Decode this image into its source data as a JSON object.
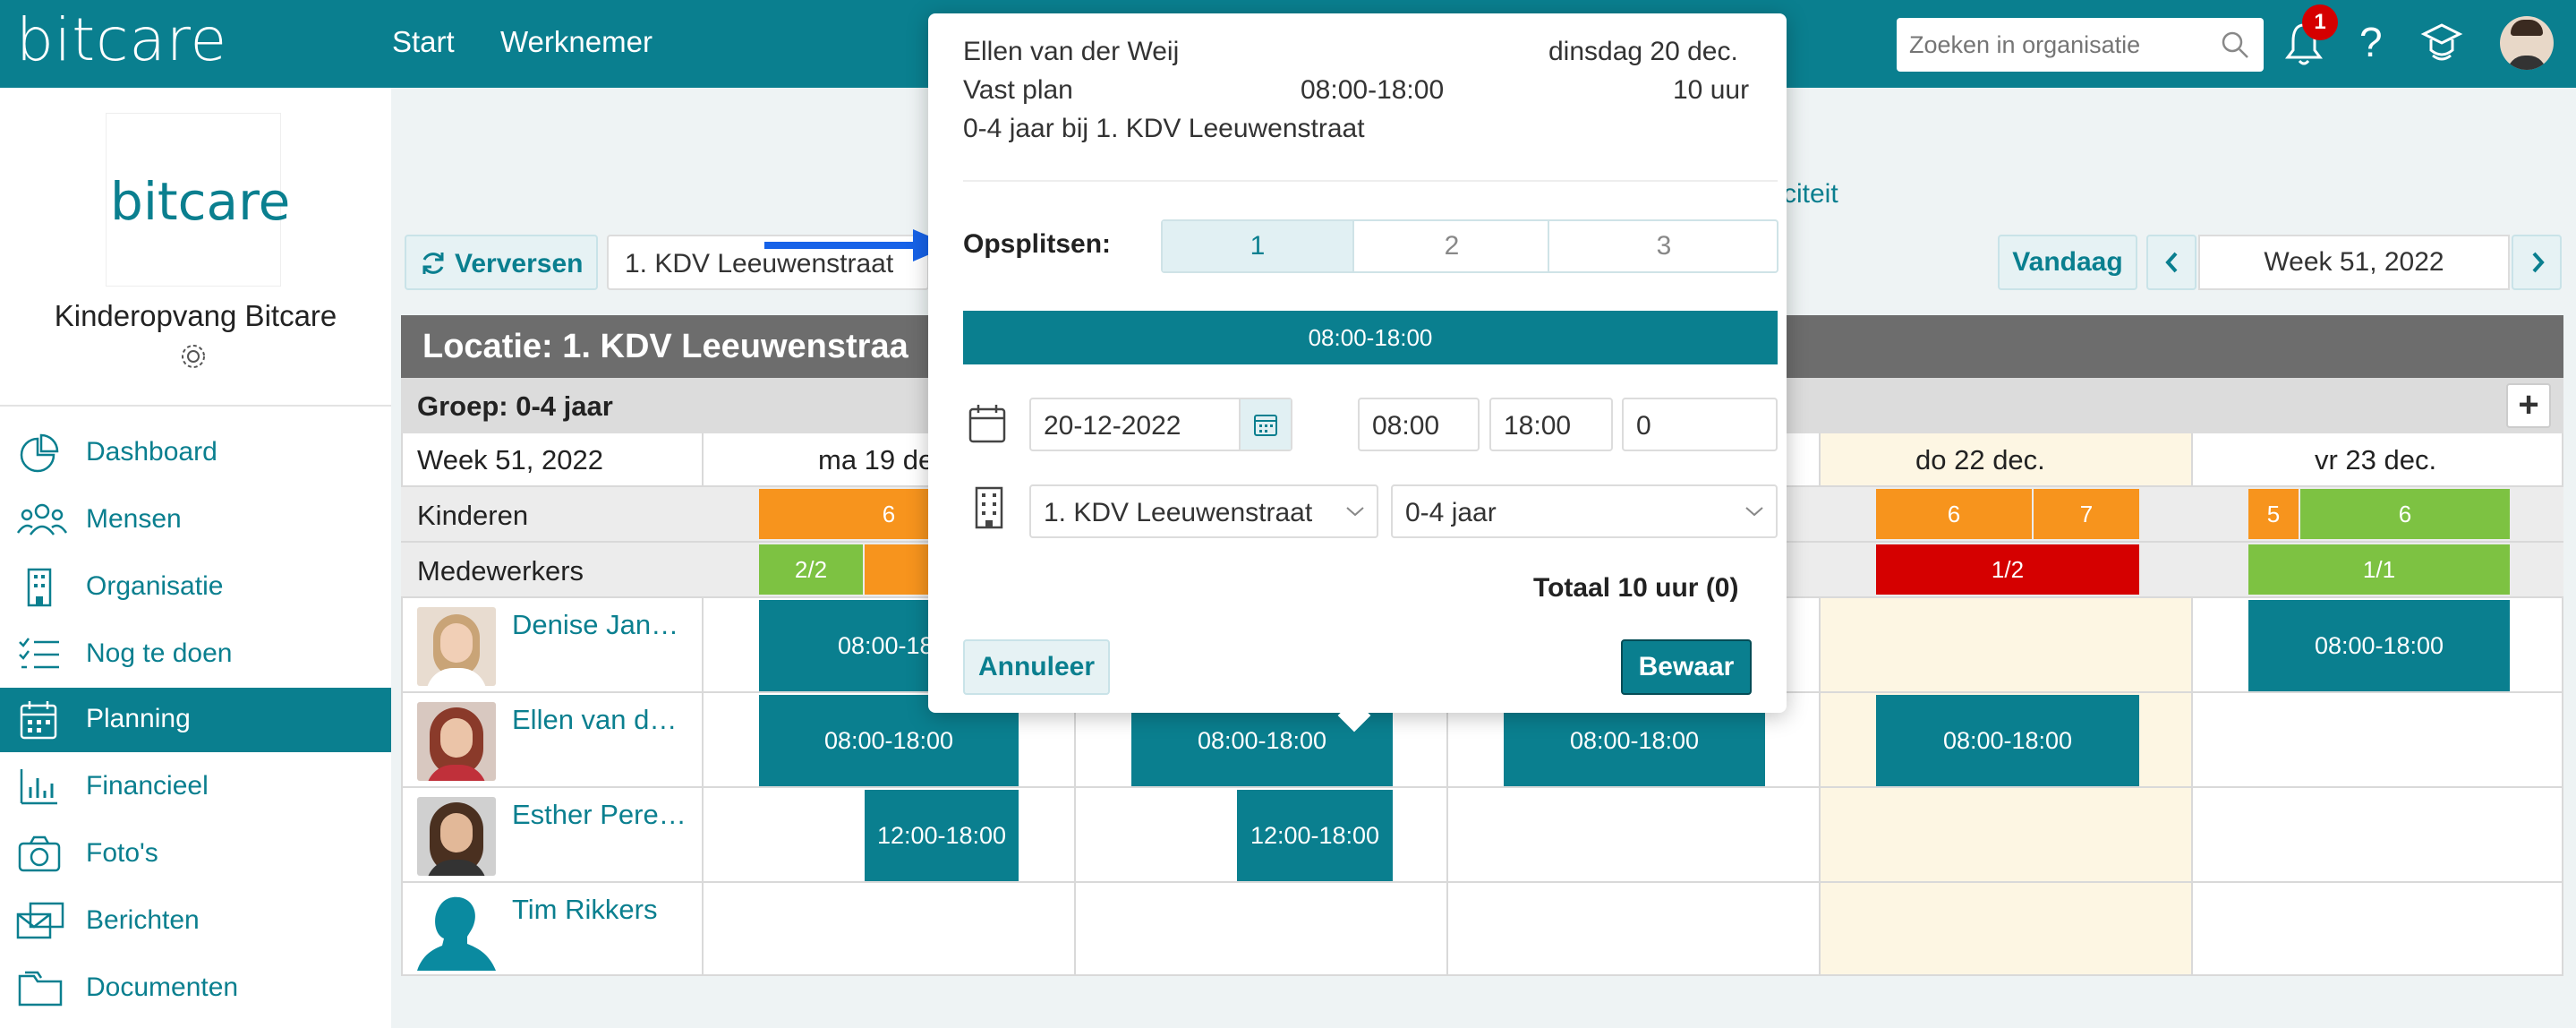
{
  "header": {
    "logo": "bitcare",
    "nav": [
      "Start",
      "Werknemer"
    ],
    "search_placeholder": "Zoeken in organisatie",
    "notification_count": "1",
    "help": "?"
  },
  "sidebar": {
    "org_logo": "bitcare",
    "org_name": "Kinderopvang Bitcare",
    "items": [
      {
        "label": "Dashboard",
        "icon": "dashboard-icon"
      },
      {
        "label": "Mensen",
        "icon": "people-icon"
      },
      {
        "label": "Organisatie",
        "icon": "building-icon"
      },
      {
        "label": "Nog te doen",
        "icon": "checklist-icon"
      },
      {
        "label": "Planning",
        "icon": "calendar-icon",
        "active": true
      },
      {
        "label": "Financieel",
        "icon": "bar-chart-icon"
      },
      {
        "label": "Foto's",
        "icon": "camera-icon"
      },
      {
        "label": "Berichten",
        "icon": "messages-icon"
      },
      {
        "label": "Documenten",
        "icon": "folder-icon"
      }
    ]
  },
  "toolbar": {
    "refresh": "Verversen",
    "location_select": "1. KDV Leeuwenstraat",
    "today": "Vandaag",
    "week": "Week 51, 2022",
    "tab_partial": "citeit"
  },
  "planning": {
    "location_title": "Locatie: 1. KDV Leeuwenstraa",
    "group_title": "Groep: 0-4 jaar",
    "week_label": "Week 51, 2022",
    "days": [
      "ma 19 de",
      "",
      "",
      "do 22 dec.",
      "vr 23 dec."
    ],
    "rows": [
      "Kinderen",
      "Medewerkers"
    ],
    "kinderen": {
      "mon": "6",
      "thu": [
        "6",
        "7"
      ],
      "fri": [
        "5",
        "6"
      ]
    },
    "medewerkers": {
      "mon": "2/2",
      "thu": "1/2",
      "fri": "1/1"
    },
    "employees": [
      {
        "name": "Denise Jan…",
        "shifts": {
          "mon": "08:00-18:",
          "fri": "08:00-18:00"
        }
      },
      {
        "name": "Ellen van d…",
        "shifts": {
          "mon": "08:00-18:00",
          "tue": "08:00-18:00",
          "wed": "08:00-18:00",
          "thu": "08:00-18:00"
        }
      },
      {
        "name": "Esther Pere…",
        "shifts": {
          "mon": "12:00-18:00",
          "tue": "12:00-18:00"
        }
      },
      {
        "name": "Tim Rikkers",
        "shifts": {}
      }
    ]
  },
  "popup": {
    "employee": "Ellen van der Weij",
    "date": "dinsdag 20 dec.",
    "plan_type": "Vast plan",
    "time": "08:00-18:00",
    "hours": "10 uur",
    "group": "0-4 jaar bij 1. KDV Leeuwenstraat",
    "split_label": "Opsplitsen:",
    "split_options": [
      "1",
      "2",
      "3"
    ],
    "segment": "08:00-18:00",
    "date_value": "20-12-2022",
    "start": "08:00",
    "end": "18:00",
    "break": "0",
    "location": "1. KDV Leeuwenstraat",
    "group_select": "0-4 jaar",
    "total": "Totaal 10 uur (0)",
    "cancel": "Annuleer",
    "save": "Bewaar"
  },
  "colors": {
    "primary": "#0a7f8f",
    "orange": "#f7941d",
    "green": "#7dc242",
    "red": "#d50000",
    "highlight": "#fdf6e3"
  }
}
